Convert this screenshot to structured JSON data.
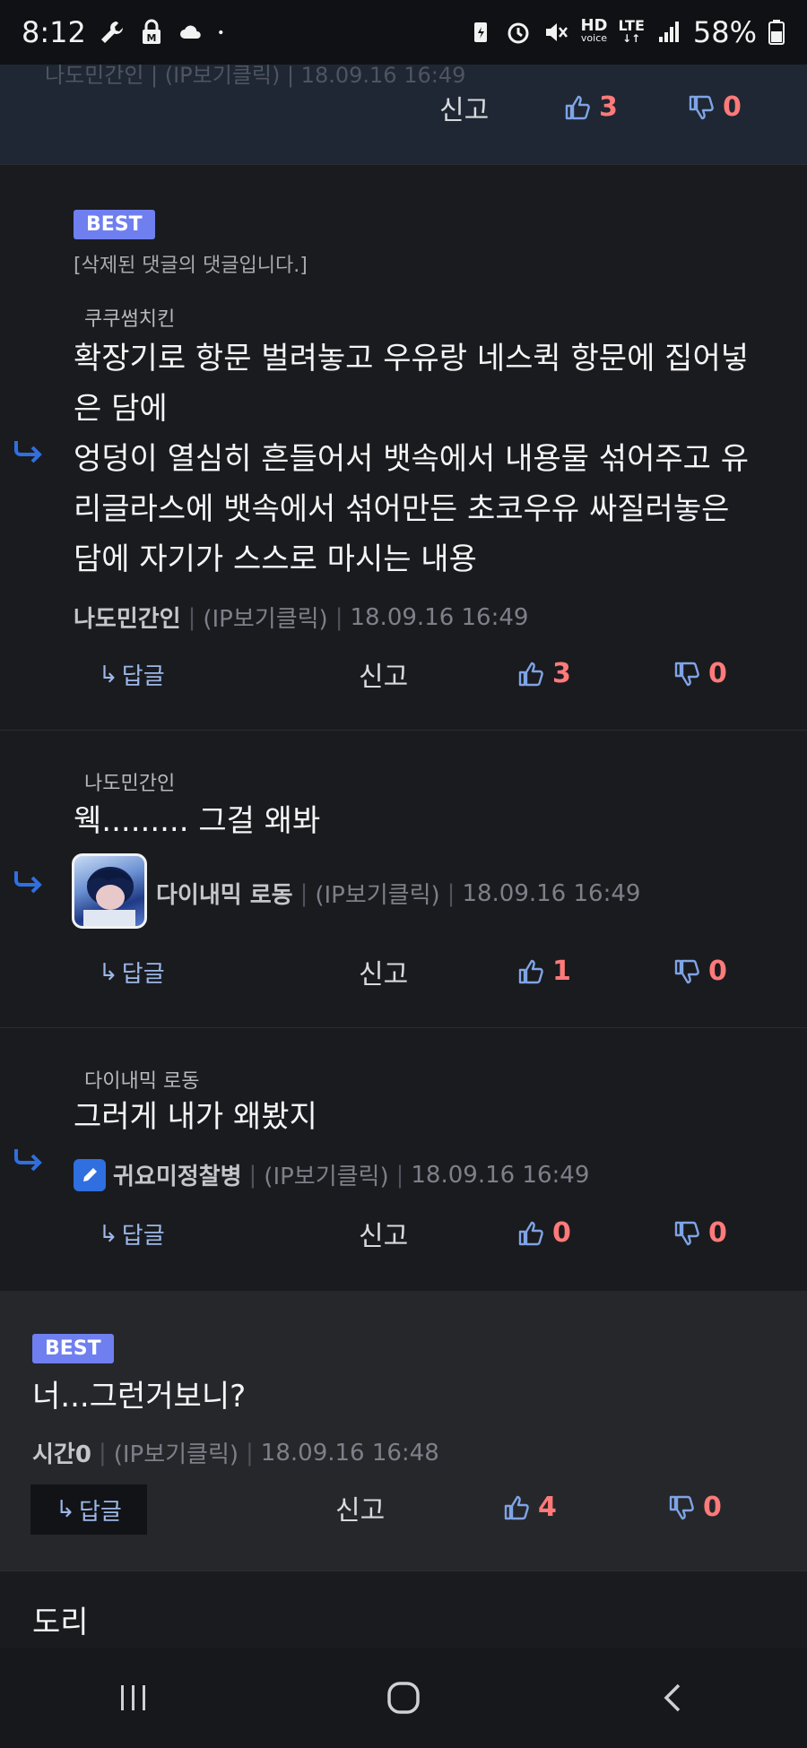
{
  "status_bar": {
    "time": "8:12",
    "battery": "58%",
    "hd_top": "HD",
    "hd_bottom": "voice",
    "lte": "LTE"
  },
  "top_block": {
    "ghost_meta": "나도민간인 | (IP보기클릭) | 18.09.16 16:49",
    "report": "신고",
    "up": "3",
    "down": "0"
  },
  "comments": [
    {
      "badge": "BEST",
      "deleted_note": "[삭제된 댓글의 댓글입니다.]",
      "mention": "쿠쿠썸치킨",
      "lines": [
        "확장기로 항문 벌려놓고 우유랑 네스퀵 항문에 집어넣",
        "은 담에",
        "엉덩이 열심히 흔들어서 뱃속에서 내용물 섞어주고 유",
        "리글라스에 뱃속에서 섞어만든 초코우유 싸질러놓은",
        "담에 자기가 스스로 마시는 내용"
      ],
      "nick": "나도민간인",
      "ip": "(IP보기클릭)",
      "date": "18.09.16 16:49",
      "reply": "답글",
      "report": "신고",
      "up": "3",
      "down": "0"
    },
    {
      "mention": "나도민간인",
      "text": "웩......... 그걸 왜봐",
      "nick": "다이내믹 로동",
      "ip": "(IP보기클릭)",
      "date": "18.09.16 16:49",
      "reply": "답글",
      "report": "신고",
      "up": "1",
      "down": "0"
    },
    {
      "mention": "다이내믹 로동",
      "text": "그러게 내가 왜봤지",
      "nick": "귀요미정찰병",
      "ip": "(IP보기클릭)",
      "date": "18.09.16 16:49",
      "reply": "답글",
      "report": "신고",
      "up": "0",
      "down": "0"
    },
    {
      "badge": "BEST",
      "text": "너...그런거보니?",
      "nick": "시간0",
      "ip": "(IP보기클릭)",
      "date": "18.09.16 16:48",
      "reply": "답글",
      "report": "신고",
      "up": "4",
      "down": "0"
    }
  ],
  "next_comment_preview": "도리",
  "colors": {
    "background": "#1a1b1f",
    "badge": "#6f7ff0",
    "vote_number": "#ff7a7a",
    "reply_link": "#9cb8e8",
    "arrow": "#2f6fe0"
  }
}
